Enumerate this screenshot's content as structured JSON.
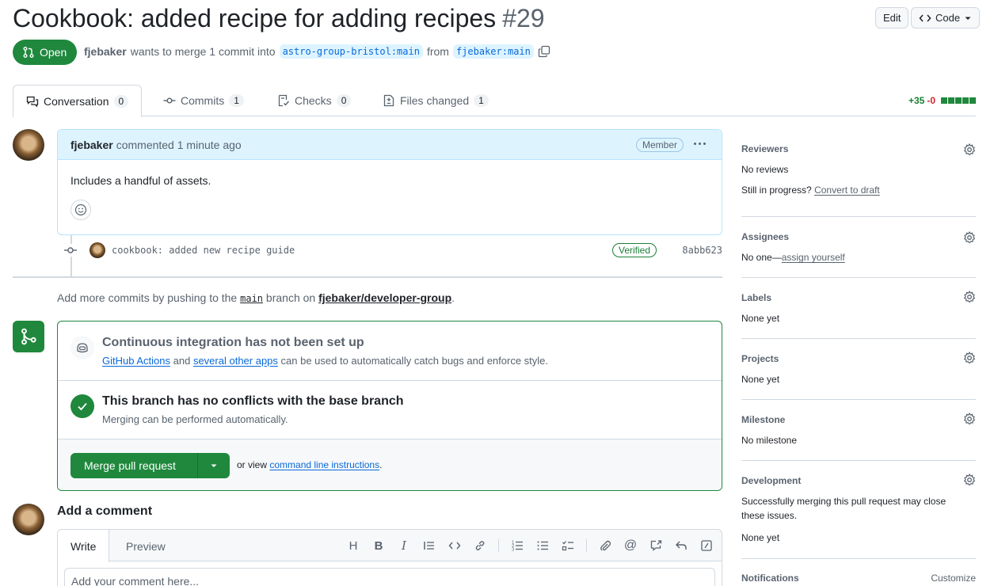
{
  "pr": {
    "title": "Cookbook: added recipe for adding recipes",
    "number": "#29",
    "state": "Open",
    "author": "fjebaker",
    "merge_text": "wants to merge 1 commit into",
    "base_branch": "astro-group-bristol:main",
    "from_text": "from",
    "head_branch": "fjebaker:main"
  },
  "header": {
    "edit_label": "Edit",
    "code_label": "Code"
  },
  "tabs": [
    {
      "label": "Conversation",
      "count": "0"
    },
    {
      "label": "Commits",
      "count": "1"
    },
    {
      "label": "Checks",
      "count": "0"
    },
    {
      "label": "Files changed",
      "count": "1"
    }
  ],
  "diffstat": {
    "additions": "+35",
    "deletions": "-0"
  },
  "comment": {
    "author": "fjebaker",
    "action": "commented",
    "time": "1 minute ago",
    "role": "Member",
    "body": "Includes a handful of assets."
  },
  "commit": {
    "message": "cookbook: added new recipe guide",
    "verified": "Verified",
    "sha": "8abb623"
  },
  "push_hint": {
    "prefix": "Add more commits by pushing to the",
    "branch": "main",
    "middle": "branch on",
    "repo": "fjebaker/developer-group",
    "suffix": "."
  },
  "merge": {
    "ci_title": "Continuous integration has not been set up",
    "ci_link1": "GitHub Actions",
    "ci_and": "and",
    "ci_link2": "several other apps",
    "ci_rest": "can be used to automatically catch bugs and enforce style.",
    "conflict_title": "This branch has no conflicts with the base branch",
    "conflict_sub": "Merging can be performed automatically.",
    "button": "Merge pull request",
    "or_view": "or view",
    "cli_link": "command line instructions",
    "cli_end": "."
  },
  "add_comment": {
    "title": "Add a comment",
    "tab_write": "Write",
    "tab_preview": "Preview",
    "placeholder": "Add your comment here..."
  },
  "sidebar": {
    "reviewers": {
      "label": "Reviewers",
      "value": "No reviews",
      "progress": "Still in progress?",
      "draft_link": "Convert to draft"
    },
    "assignees": {
      "label": "Assignees",
      "value": "No one—",
      "link": "assign yourself"
    },
    "labels": {
      "label": "Labels",
      "value": "None yet"
    },
    "projects": {
      "label": "Projects",
      "value": "None yet"
    },
    "milestone": {
      "label": "Milestone",
      "value": "No milestone"
    },
    "development": {
      "label": "Development",
      "text1": "Successfully merging this pull request may close",
      "text2": "these issues.",
      "value": "None yet"
    },
    "notifications": {
      "label": "Notifications",
      "customize": "Customize"
    }
  },
  "colors": {
    "accent_green": "#1f883d",
    "link_blue": "#0969da",
    "muted": "#59636e"
  }
}
